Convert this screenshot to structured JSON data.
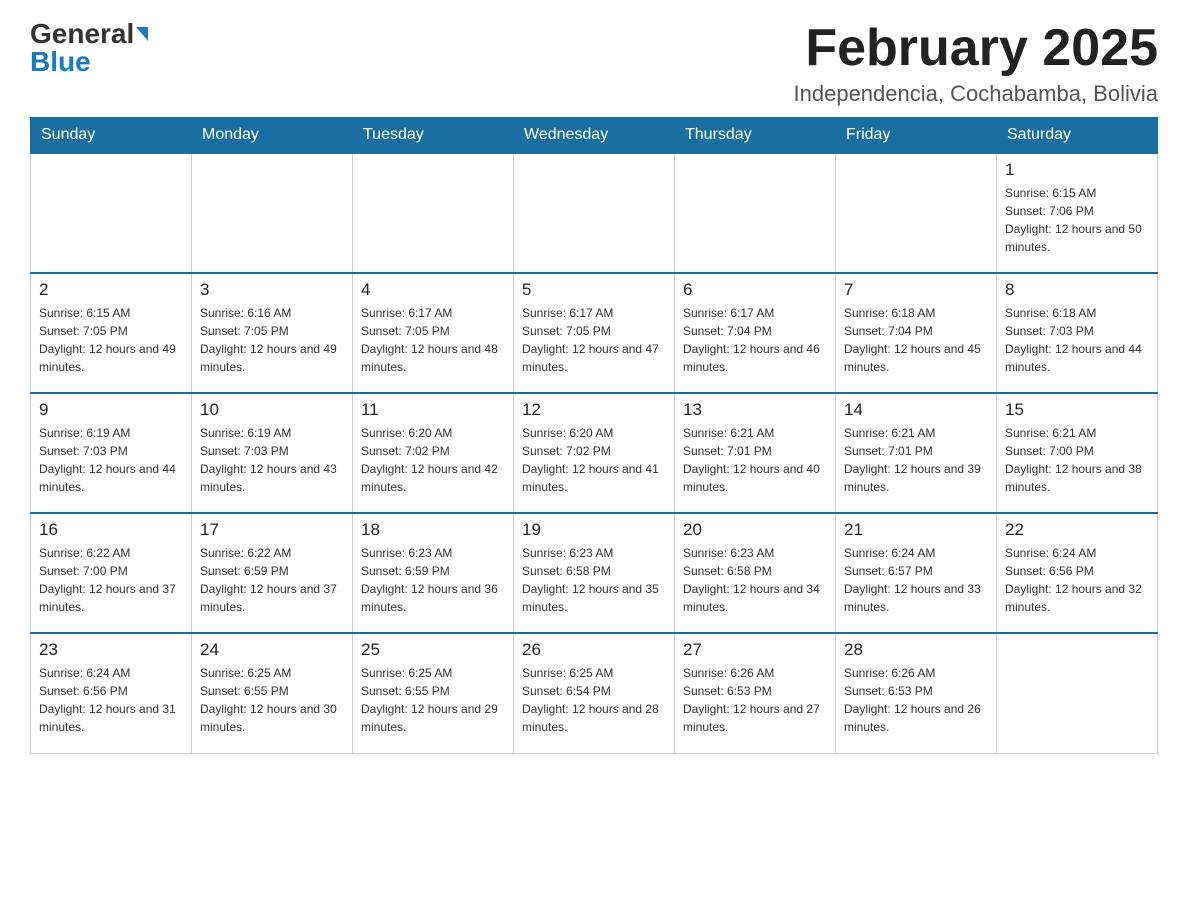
{
  "header": {
    "logo_general": "General",
    "logo_blue": "Blue",
    "month_title": "February 2025",
    "location": "Independencia, Cochabamba, Bolivia"
  },
  "days_of_week": [
    "Sunday",
    "Monday",
    "Tuesday",
    "Wednesday",
    "Thursday",
    "Friday",
    "Saturday"
  ],
  "weeks": [
    [
      {
        "day": "",
        "sunrise": "",
        "sunset": "",
        "daylight": ""
      },
      {
        "day": "",
        "sunrise": "",
        "sunset": "",
        "daylight": ""
      },
      {
        "day": "",
        "sunrise": "",
        "sunset": "",
        "daylight": ""
      },
      {
        "day": "",
        "sunrise": "",
        "sunset": "",
        "daylight": ""
      },
      {
        "day": "",
        "sunrise": "",
        "sunset": "",
        "daylight": ""
      },
      {
        "day": "",
        "sunrise": "",
        "sunset": "",
        "daylight": ""
      },
      {
        "day": "1",
        "sunrise": "Sunrise: 6:15 AM",
        "sunset": "Sunset: 7:06 PM",
        "daylight": "Daylight: 12 hours and 50 minutes."
      }
    ],
    [
      {
        "day": "2",
        "sunrise": "Sunrise: 6:15 AM",
        "sunset": "Sunset: 7:05 PM",
        "daylight": "Daylight: 12 hours and 49 minutes."
      },
      {
        "day": "3",
        "sunrise": "Sunrise: 6:16 AM",
        "sunset": "Sunset: 7:05 PM",
        "daylight": "Daylight: 12 hours and 49 minutes."
      },
      {
        "day": "4",
        "sunrise": "Sunrise: 6:17 AM",
        "sunset": "Sunset: 7:05 PM",
        "daylight": "Daylight: 12 hours and 48 minutes."
      },
      {
        "day": "5",
        "sunrise": "Sunrise: 6:17 AM",
        "sunset": "Sunset: 7:05 PM",
        "daylight": "Daylight: 12 hours and 47 minutes."
      },
      {
        "day": "6",
        "sunrise": "Sunrise: 6:17 AM",
        "sunset": "Sunset: 7:04 PM",
        "daylight": "Daylight: 12 hours and 46 minutes."
      },
      {
        "day": "7",
        "sunrise": "Sunrise: 6:18 AM",
        "sunset": "Sunset: 7:04 PM",
        "daylight": "Daylight: 12 hours and 45 minutes."
      },
      {
        "day": "8",
        "sunrise": "Sunrise: 6:18 AM",
        "sunset": "Sunset: 7:03 PM",
        "daylight": "Daylight: 12 hours and 44 minutes."
      }
    ],
    [
      {
        "day": "9",
        "sunrise": "Sunrise: 6:19 AM",
        "sunset": "Sunset: 7:03 PM",
        "daylight": "Daylight: 12 hours and 44 minutes."
      },
      {
        "day": "10",
        "sunrise": "Sunrise: 6:19 AM",
        "sunset": "Sunset: 7:03 PM",
        "daylight": "Daylight: 12 hours and 43 minutes."
      },
      {
        "day": "11",
        "sunrise": "Sunrise: 6:20 AM",
        "sunset": "Sunset: 7:02 PM",
        "daylight": "Daylight: 12 hours and 42 minutes."
      },
      {
        "day": "12",
        "sunrise": "Sunrise: 6:20 AM",
        "sunset": "Sunset: 7:02 PM",
        "daylight": "Daylight: 12 hours and 41 minutes."
      },
      {
        "day": "13",
        "sunrise": "Sunrise: 6:21 AM",
        "sunset": "Sunset: 7:01 PM",
        "daylight": "Daylight: 12 hours and 40 minutes."
      },
      {
        "day": "14",
        "sunrise": "Sunrise: 6:21 AM",
        "sunset": "Sunset: 7:01 PM",
        "daylight": "Daylight: 12 hours and 39 minutes."
      },
      {
        "day": "15",
        "sunrise": "Sunrise: 6:21 AM",
        "sunset": "Sunset: 7:00 PM",
        "daylight": "Daylight: 12 hours and 38 minutes."
      }
    ],
    [
      {
        "day": "16",
        "sunrise": "Sunrise: 6:22 AM",
        "sunset": "Sunset: 7:00 PM",
        "daylight": "Daylight: 12 hours and 37 minutes."
      },
      {
        "day": "17",
        "sunrise": "Sunrise: 6:22 AM",
        "sunset": "Sunset: 6:59 PM",
        "daylight": "Daylight: 12 hours and 37 minutes."
      },
      {
        "day": "18",
        "sunrise": "Sunrise: 6:23 AM",
        "sunset": "Sunset: 6:59 PM",
        "daylight": "Daylight: 12 hours and 36 minutes."
      },
      {
        "day": "19",
        "sunrise": "Sunrise: 6:23 AM",
        "sunset": "Sunset: 6:58 PM",
        "daylight": "Daylight: 12 hours and 35 minutes."
      },
      {
        "day": "20",
        "sunrise": "Sunrise: 6:23 AM",
        "sunset": "Sunset: 6:58 PM",
        "daylight": "Daylight: 12 hours and 34 minutes."
      },
      {
        "day": "21",
        "sunrise": "Sunrise: 6:24 AM",
        "sunset": "Sunset: 6:57 PM",
        "daylight": "Daylight: 12 hours and 33 minutes."
      },
      {
        "day": "22",
        "sunrise": "Sunrise: 6:24 AM",
        "sunset": "Sunset: 6:56 PM",
        "daylight": "Daylight: 12 hours and 32 minutes."
      }
    ],
    [
      {
        "day": "23",
        "sunrise": "Sunrise: 6:24 AM",
        "sunset": "Sunset: 6:56 PM",
        "daylight": "Daylight: 12 hours and 31 minutes."
      },
      {
        "day": "24",
        "sunrise": "Sunrise: 6:25 AM",
        "sunset": "Sunset: 6:55 PM",
        "daylight": "Daylight: 12 hours and 30 minutes."
      },
      {
        "day": "25",
        "sunrise": "Sunrise: 6:25 AM",
        "sunset": "Sunset: 6:55 PM",
        "daylight": "Daylight: 12 hours and 29 minutes."
      },
      {
        "day": "26",
        "sunrise": "Sunrise: 6:25 AM",
        "sunset": "Sunset: 6:54 PM",
        "daylight": "Daylight: 12 hours and 28 minutes."
      },
      {
        "day": "27",
        "sunrise": "Sunrise: 6:26 AM",
        "sunset": "Sunset: 6:53 PM",
        "daylight": "Daylight: 12 hours and 27 minutes."
      },
      {
        "day": "28",
        "sunrise": "Sunrise: 6:26 AM",
        "sunset": "Sunset: 6:53 PM",
        "daylight": "Daylight: 12 hours and 26 minutes."
      },
      {
        "day": "",
        "sunrise": "",
        "sunset": "",
        "daylight": ""
      }
    ]
  ]
}
